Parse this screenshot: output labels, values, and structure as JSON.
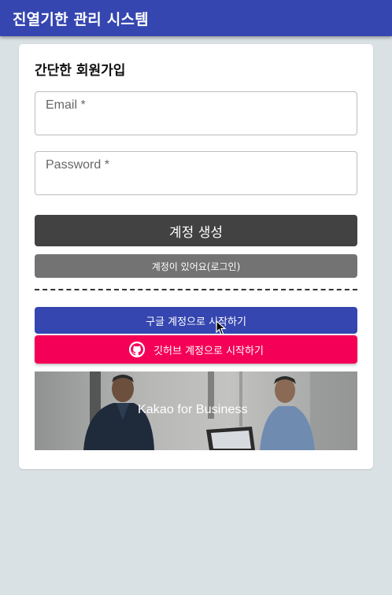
{
  "app": {
    "title": "진열기한 관리 시스템"
  },
  "signup": {
    "title": "간단한 회원가입",
    "email": {
      "label": "Email *",
      "value": ""
    },
    "password": {
      "label": "Password *",
      "value": ""
    },
    "create_button": "계정 생성",
    "login_button": "계정이 있어요(로그인)"
  },
  "social": {
    "google_button": "구글 계정으로 시작하기",
    "github_button": "깃허브 계정으로 시작하기",
    "github_icon": "github-icon"
  },
  "banner": {
    "text": "Kakao for Business"
  },
  "colors": {
    "primary": "#3546b0",
    "github": "#f50057",
    "create": "#424242",
    "login": "#737373",
    "background": "#dae1e4"
  }
}
